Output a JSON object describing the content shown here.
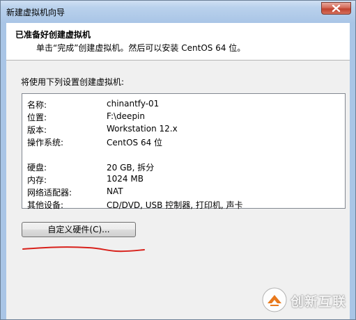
{
  "window": {
    "title": "新建虚拟机向导"
  },
  "header": {
    "title": "已准备好创建虚拟机",
    "subtitle": "单击“完成”创建虚拟机。然后可以安装 CentOS 64 位。"
  },
  "settings": {
    "intro": "将使用下列设置创建虚拟机:",
    "rows": [
      {
        "label": "名称:",
        "value": "chinantfy-01"
      },
      {
        "label": "位置:",
        "value": "F:\\deepin"
      },
      {
        "label": "版本:",
        "value": "Workstation 12.x"
      },
      {
        "label": "操作系统:",
        "value": "CentOS 64 位"
      },
      {
        "label": "硬盘:",
        "value": "20 GB, 拆分"
      },
      {
        "label": "内存:",
        "value": "1024 MB"
      },
      {
        "label": "网络适配器:",
        "value": "NAT"
      },
      {
        "label": "其他设备:",
        "value": "CD/DVD, USB 控制器, 打印机, 声卡"
      }
    ]
  },
  "buttons": {
    "customize_hardware": "自定义硬件(C)..."
  },
  "watermark": {
    "text": "创新互联"
  },
  "colors": {
    "annotation_red": "#d8201a",
    "watermark_orange": "#e8791c"
  },
  "icons": {
    "close": "close-icon",
    "watermark_logo": "brand-logo-icon"
  }
}
